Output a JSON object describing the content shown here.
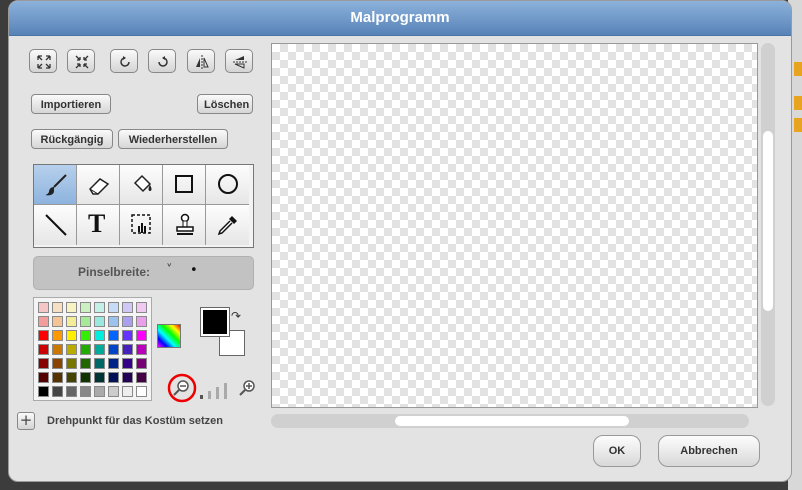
{
  "window": {
    "title": "Malprogramm"
  },
  "buttons": {
    "import": "Importieren",
    "clear": "Löschen",
    "undo": "Rückgängig",
    "redo": "Wiederherstellen",
    "ok": "OK",
    "cancel": "Abbrechen"
  },
  "toolbar_icons": [
    "grow-icon",
    "shrink-icon",
    "rotate-left-icon",
    "rotate-right-icon",
    "flip-horizontal-icon",
    "flip-vertical-icon"
  ],
  "tools": [
    {
      "name": "paintbrush-tool",
      "selected": true
    },
    {
      "name": "eraser-tool",
      "selected": false
    },
    {
      "name": "fill-bucket-tool",
      "selected": false
    },
    {
      "name": "rectangle-tool",
      "selected": false
    },
    {
      "name": "ellipse-tool",
      "selected": false
    },
    {
      "name": "line-tool",
      "selected": false
    },
    {
      "name": "text-tool",
      "selected": false,
      "glyph": "T"
    },
    {
      "name": "select-tool",
      "selected": false
    },
    {
      "name": "stamp-tool",
      "selected": false
    },
    {
      "name": "eyedropper-tool",
      "selected": false
    }
  ],
  "brush": {
    "label": "Pinselbreite:",
    "dropdown_glyph": "˅",
    "dot_glyph": "•"
  },
  "palette": {
    "rows": [
      [
        "#f6c6c6",
        "#f7dfc4",
        "#f7f3c3",
        "#cdf0c3",
        "#c4f0e8",
        "#c6dcf6",
        "#cfc8f6",
        "#f1c8f2"
      ],
      [
        "#f29c9c",
        "#f4c497",
        "#f3ec98",
        "#a8e899",
        "#9be8de",
        "#9cc2ee",
        "#aaa0ee",
        "#e8a0ea"
      ],
      [
        "#ff0000",
        "#ff9900",
        "#ffee00",
        "#33ee00",
        "#00eedd",
        "#0066ff",
        "#6633ff",
        "#ff00ff"
      ],
      [
        "#cc0000",
        "#cc7700",
        "#bbaa00",
        "#22aa00",
        "#00aa99",
        "#0044cc",
        "#4422bb",
        "#bb00bb"
      ],
      [
        "#880000",
        "#884400",
        "#777700",
        "#226600",
        "#006666",
        "#002288",
        "#330088",
        "#770077"
      ],
      [
        "#550000",
        "#553300",
        "#444400",
        "#113300",
        "#003333",
        "#001155",
        "#220055",
        "#440044"
      ],
      [
        "#000000",
        "#444444",
        "#666666",
        "#888888",
        "#aaaaaa",
        "#cccccc",
        "#eeeeee",
        "#ffffff"
      ]
    ]
  },
  "colors": {
    "foreground": "#000000",
    "background": "#ffffff"
  },
  "zoom": {
    "out_icon": "zoom-out-icon",
    "in_icon": "zoom-in-icon",
    "level_bars": 4,
    "active_bars": 1
  },
  "pivot": {
    "plus_glyph": "+",
    "label": "Drehpunkt für das Kostüm setzen"
  }
}
